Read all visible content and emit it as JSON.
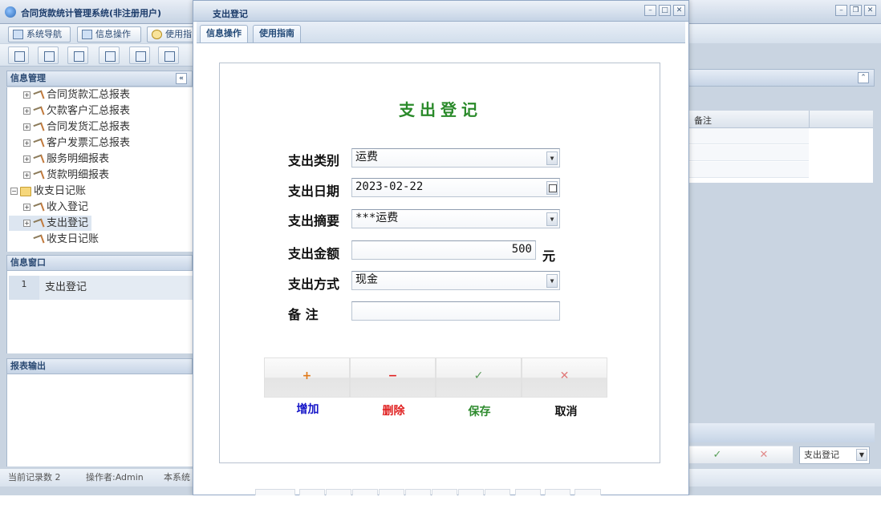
{
  "app": {
    "title": "合同货款统计管理系统(非注册用户)",
    "menu": [
      "系统导航",
      "信息操作",
      "使用指"
    ]
  },
  "info_panel": {
    "title": "信息管理",
    "collapse_icon": "«"
  },
  "tree": [
    {
      "label": "合同货款汇总报表",
      "level": 1,
      "expander": "+"
    },
    {
      "label": "欠款客户汇总报表",
      "level": 1,
      "expander": "+"
    },
    {
      "label": "合同发货汇总报表",
      "level": 1,
      "expander": "+"
    },
    {
      "label": "客户发票汇总报表",
      "level": 1,
      "expander": "+"
    },
    {
      "label": "服务明细报表",
      "level": 1,
      "expander": "+"
    },
    {
      "label": "货款明细报表",
      "level": 1,
      "expander": "+"
    },
    {
      "label": "收支日记账",
      "level": 0,
      "expander": "−"
    },
    {
      "label": "收入登记",
      "level": 1,
      "expander": "+"
    },
    {
      "label": "支出登记",
      "level": 1,
      "expander": "+"
    },
    {
      "label": "收支日记账",
      "level": 1,
      "expander": ""
    }
  ],
  "info_window": {
    "title": "信息窗口",
    "row_num": "1",
    "row_text": "支出登记"
  },
  "report": {
    "title": "报表输出"
  },
  "status": {
    "records": "当前记录数 2",
    "operator": "操作者:Admin",
    "system": "本系统"
  },
  "right": {
    "grid_header": "备注",
    "select_value": "支出登记",
    "btn_ok": "✓",
    "btn_cancel": "✕"
  },
  "dialog": {
    "title": "支出登记",
    "tabs": [
      "信息操作",
      "使用指南"
    ],
    "form_title": "支出登记",
    "fields": {
      "category_label": "支出类别",
      "category_value": "运费",
      "date_label": "支出日期",
      "date_value": "2023-02-22",
      "summary_label": "支出摘要",
      "summary_value": "***运费",
      "amount_label": "支出金额",
      "amount_value": "500",
      "amount_unit": "元",
      "method_label": "支出方式",
      "method_value": "现金",
      "note_label": "备 注",
      "note_value": ""
    },
    "buttons": {
      "add": {
        "icon": "+",
        "label": "增加"
      },
      "delete": {
        "icon": "−",
        "label": "删除"
      },
      "save": {
        "icon": "✓",
        "label": "保存"
      },
      "cancel": {
        "icon": "✕",
        "label": "取消"
      }
    }
  },
  "colors": {
    "title_green": "#2a8a2a",
    "add_blue": "#1515c8",
    "delete_red": "#e02020",
    "save_green": "#2e8b2e"
  }
}
